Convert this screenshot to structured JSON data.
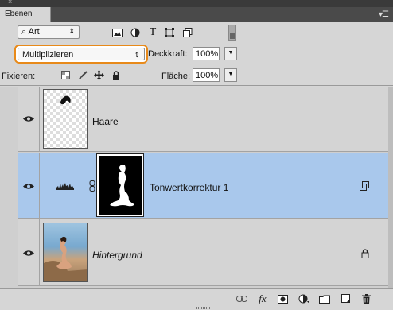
{
  "window": {
    "close_glyph": "×"
  },
  "panel": {
    "tab_label": "Ebenen",
    "menu_icon": "panel-menu-icon"
  },
  "filter": {
    "kind_label": "Art",
    "search_glyph": "⌕",
    "icons": [
      "image-filter-icon",
      "adjustment-filter-icon",
      "text-filter-icon",
      "shape-filter-icon",
      "smartobject-filter-icon"
    ]
  },
  "blending": {
    "mode": "Multiplizieren",
    "opacity_label": "Deckkraft:",
    "opacity_value": "100%",
    "fill_label": "Fläche:",
    "fill_value": "100%"
  },
  "lock": {
    "label": "Fixieren:",
    "icons": [
      "lock-transparency-icon",
      "lock-pixels-icon",
      "lock-position-icon",
      "lock-all-icon"
    ]
  },
  "layers": [
    {
      "name": "Haare",
      "visible": true,
      "selected": false,
      "italic": false
    },
    {
      "name": "Tonwertkorrektur 1",
      "visible": true,
      "selected": true,
      "italic": false
    },
    {
      "name": "Hintergrund",
      "visible": true,
      "selected": false,
      "italic": true,
      "locked": true
    }
  ],
  "footer_icons": [
    "link-layers-icon",
    "fx-icon",
    "add-mask-icon",
    "new-adjustment-icon",
    "new-group-icon",
    "new-layer-icon",
    "delete-layer-icon"
  ],
  "colors": {
    "selection": "#a9c8ec",
    "highlight_ring": "#e88a1a"
  }
}
